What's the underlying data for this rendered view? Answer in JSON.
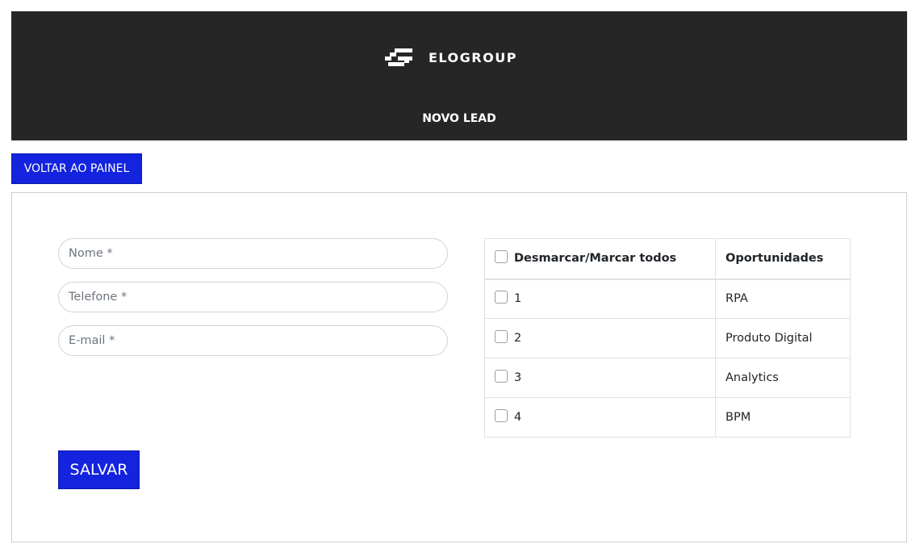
{
  "header": {
    "logo_text": "ELOGROUP",
    "title": "NOVO LEAD",
    "background": "#262626"
  },
  "back_button": {
    "label": "VOLTAR AO PAINEL"
  },
  "form": {
    "name_placeholder": "Nome *",
    "phone_placeholder": "Telefone *",
    "email_placeholder": "E-mail *",
    "save_label": "SALVAR"
  },
  "table": {
    "columns": [
      "Desmarcar/Marcar todos",
      "Oportunidades"
    ],
    "rows": [
      {
        "id": "1",
        "opportunity": "RPA"
      },
      {
        "id": "2",
        "opportunity": "Produto Digital"
      },
      {
        "id": "3",
        "opportunity": "Analytics"
      },
      {
        "id": "4",
        "opportunity": "BPM"
      }
    ]
  },
  "colors": {
    "accent": "#1323de",
    "header_bg": "#262626"
  },
  "icons": {
    "logo": "elogroup-logo-icon",
    "checkbox": "checkbox-icon"
  }
}
